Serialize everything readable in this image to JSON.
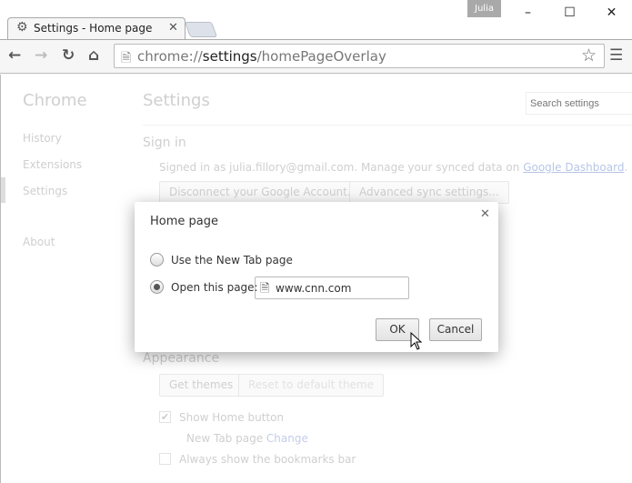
{
  "window": {
    "profile": "Julia",
    "minimize_icon": "minimize-icon",
    "maximize_icon": "maximize-icon",
    "close_icon": "close-icon"
  },
  "tab": {
    "title": "Settings - Home page",
    "icon": "gear-icon"
  },
  "toolbar": {
    "url_scheme": "chrome://",
    "url_host": "settings",
    "url_path": "/homePageOverlay"
  },
  "sidebar": {
    "title": "Chrome",
    "items": [
      {
        "label": "History"
      },
      {
        "label": "Extensions"
      },
      {
        "label": "Settings"
      },
      {
        "label": "About"
      }
    ]
  },
  "main": {
    "title": "Settings",
    "search_placeholder": "Search settings",
    "signin": {
      "heading": "Sign in",
      "text": "Signed in as julia.fillory@gmail.com. Manage your synced data on ",
      "link": "Google Dashboard",
      "period": ".",
      "disconnect": "Disconnect your Google Account...",
      "advanced": "Advanced sync settings..."
    },
    "appearance": {
      "heading": "Appearance",
      "get_themes": "Get themes",
      "reset_theme": "Reset to default theme",
      "show_home": "Show Home button",
      "show_home_checked": true,
      "newtab_text": "New Tab page",
      "change_link": "Change",
      "bookmarks": "Always show the bookmarks bar",
      "bookmarks_checked": false
    }
  },
  "dialog": {
    "title": "Home page",
    "option_newtab": "Use the New Tab page",
    "option_open": "Open this page:",
    "selected": "open",
    "url_value": "www.cnn.com",
    "ok": "OK",
    "cancel": "Cancel"
  }
}
